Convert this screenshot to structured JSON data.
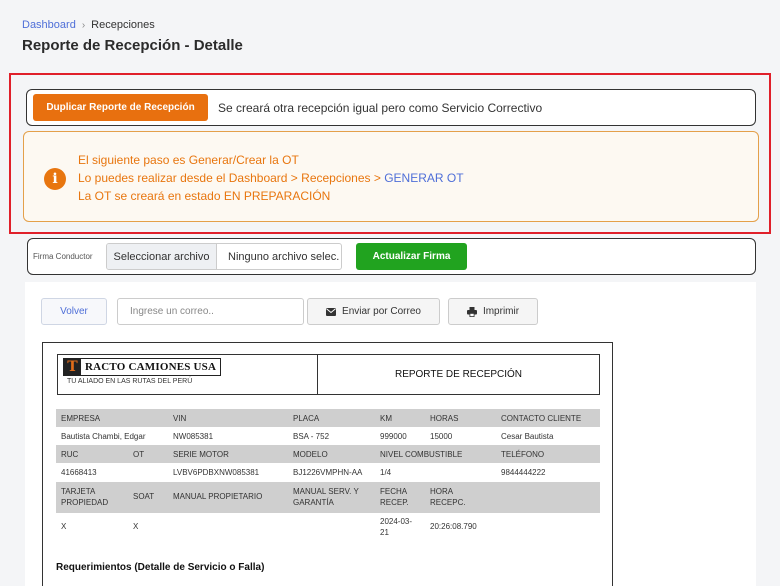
{
  "breadcrumb": {
    "home": "Dashboard",
    "separator": "›",
    "current": "Recepciones"
  },
  "page_title": "Reporte de Recepción - Detalle",
  "duplicate": {
    "button_label": "Duplicar Reporte de Recepción",
    "description": "Se creará otra recepción igual pero como Servicio Correctivo"
  },
  "info": {
    "icon": "i",
    "line1": "El siguiente paso es Generar/Crear la OT",
    "line2_prefix": "Lo puedes realizar desde el Dashboard > Recepciones > ",
    "line2_link": "GENERAR OT",
    "line3": "La OT se creará en estado EN PREPARACIÓN"
  },
  "firma": {
    "label": "Firma Conductor",
    "file_button": "Seleccionar archivo",
    "file_none": "Ninguno archivo selec.",
    "update_button": "Actualizar Firma"
  },
  "actions": {
    "back": "Volver",
    "email_placeholder": "Ingrese un correo..",
    "send_email": "Enviar por Correo",
    "print": "Imprimir"
  },
  "report": {
    "logo_letter": "T",
    "logo_name": "RACTO CAMIONES USA",
    "logo_slogan": "TU ALIADO EN LAS RUTAS DEL PERÚ",
    "title": "REPORTE DE RECEPCIÓN",
    "row1_headers": [
      "EMPRESA",
      "VIN",
      "PLACA",
      "KM",
      "HORAS",
      "CONTACTO CLIENTE"
    ],
    "row1_values": [
      "Bautista Chambi, Edgar",
      "NW085381",
      "BSA - 752",
      "999000",
      "15000",
      "Cesar Bautista"
    ],
    "row2_headers": [
      "RUC",
      "OT",
      "SERIE MOTOR",
      "MODELO",
      "NIVEL COMBUSTIBLE",
      "TELÉFONO"
    ],
    "row2_values": [
      "41668413",
      "",
      "LVBV6PDBXNW085381",
      "BJ1226VMPHN-AA",
      "1/4",
      "9844444222"
    ],
    "row3_headers": [
      [
        "TARJETA",
        "PROPIEDAD"
      ],
      [
        "SOAT"
      ],
      [
        "MANUAL PROPIETARIO"
      ],
      [
        "MANUAL SERV. Y",
        "GARANTÍA"
      ],
      [
        "FECHA",
        "RECEP."
      ],
      [
        "HORA",
        "RECEPC."
      ]
    ],
    "row3_values": [
      [
        "X"
      ],
      [
        "X"
      ],
      [
        ""
      ],
      [
        ""
      ],
      [
        "2024-03-",
        "21"
      ],
      [
        "20:26:08.790"
      ]
    ],
    "requirements_title": "Requerimientos (Detalle de Servicio o Falla)"
  }
}
